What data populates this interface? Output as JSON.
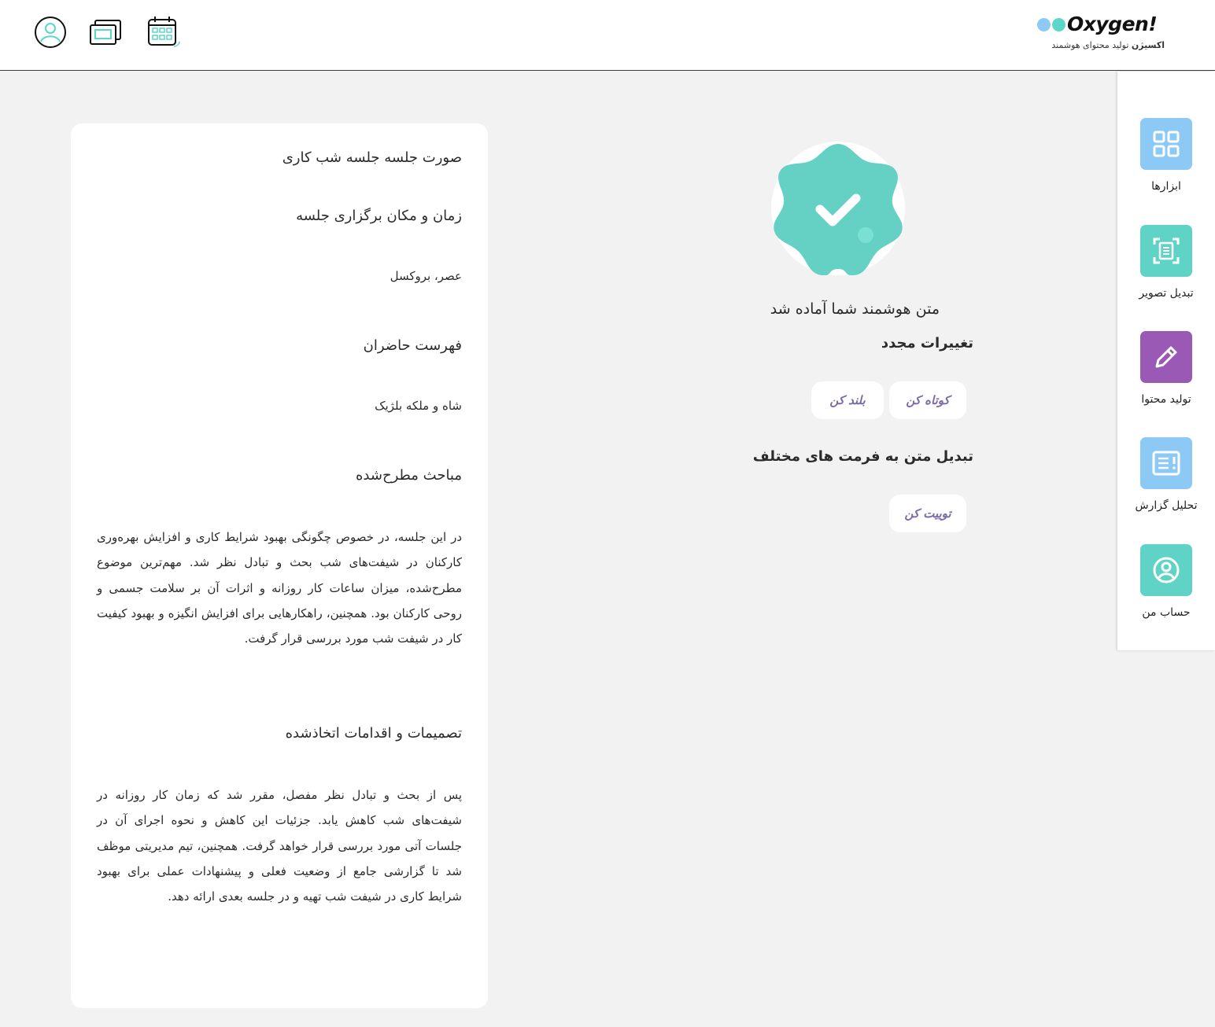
{
  "header": {
    "brand_name": "Oxygen!",
    "brand_sub_bold": "اکسیژن",
    "brand_sub": "تولید محتوای هوشمند",
    "colors": {
      "dot1": "#8cc9f5",
      "dot2": "#5cd6c8",
      "o_fill": "#9b59b6"
    },
    "icons": [
      "user-icon",
      "monitor-icon",
      "calendar-icon"
    ]
  },
  "sidebar": {
    "items": [
      {
        "label": "ابزارها",
        "icon": "grid-icon",
        "color": "#8cc9f5"
      },
      {
        "label": "تبدیل تصویر",
        "icon": "scan-document-icon",
        "color": "#5fd3c6"
      },
      {
        "label": "تولید محتوا",
        "icon": "pencil-icon",
        "color": "#9b59b6"
      },
      {
        "label": "تحلیل گزارش",
        "icon": "report-icon",
        "color": "#8cc9f5"
      },
      {
        "label": "حساب من",
        "icon": "account-icon",
        "color": "#5fd3c6"
      }
    ]
  },
  "result": {
    "badge_color": "#64d1c4",
    "title": "متن هوشمند شما آماده شد",
    "changes_heading": "تغییرات مجدد",
    "shorten_label": "کوتاه کن",
    "lengthen_label": "بلند کن",
    "format_heading": "تبدیل متن به فرمت های مختلف",
    "tweet_label": "توییت کن"
  },
  "document": {
    "title": "صورت جلسه جلسه شب کاری",
    "time_heading": "زمان و مکان برگزاری جلسه",
    "time_value": "عصر، بروکسل",
    "attendees_heading": "فهرست حاضران",
    "attendees_value": "شاه و ملکه بلژیک",
    "topics_heading": "مباحث مطرح‌شده",
    "topics_text": "در این جلسه، در خصوص چگونگی بهبود شرایط کاری و افزایش بهره‌وری کارکنان در شیفت‌های شب بحث و تبادل نظر شد. مهم‌ترین موضوع مطرح‌شده، میزان ساعات کار روزانه و اثرات آن بر سلامت جسمی و روحی کارکنان بود. همچنین، راهکارهایی برای افزایش انگیزه و بهبود کیفیت کار در شیفت شب مورد بررسی قرار گرفت.",
    "decisions_heading": "تصمیمات و اقدامات اتخاذشده",
    "decisions_text": "پس از بحث و تبادل نظر مفصل، مقرر شد که زمان کار روزانه در شیفت‌های شب کاهش یابد. جزئیات این کاهش و نحوه اجرای آن در جلسات آتی مورد بررسی قرار خواهد گرفت. همچنین، تیم مدیریتی موظف شد تا گزارشی جامع از وضعیت فعلی و پیشنهادات عملی برای بهبود شرایط کاری در شیفت شب تهیه و در جلسه بعدی ارائه دهد."
  }
}
